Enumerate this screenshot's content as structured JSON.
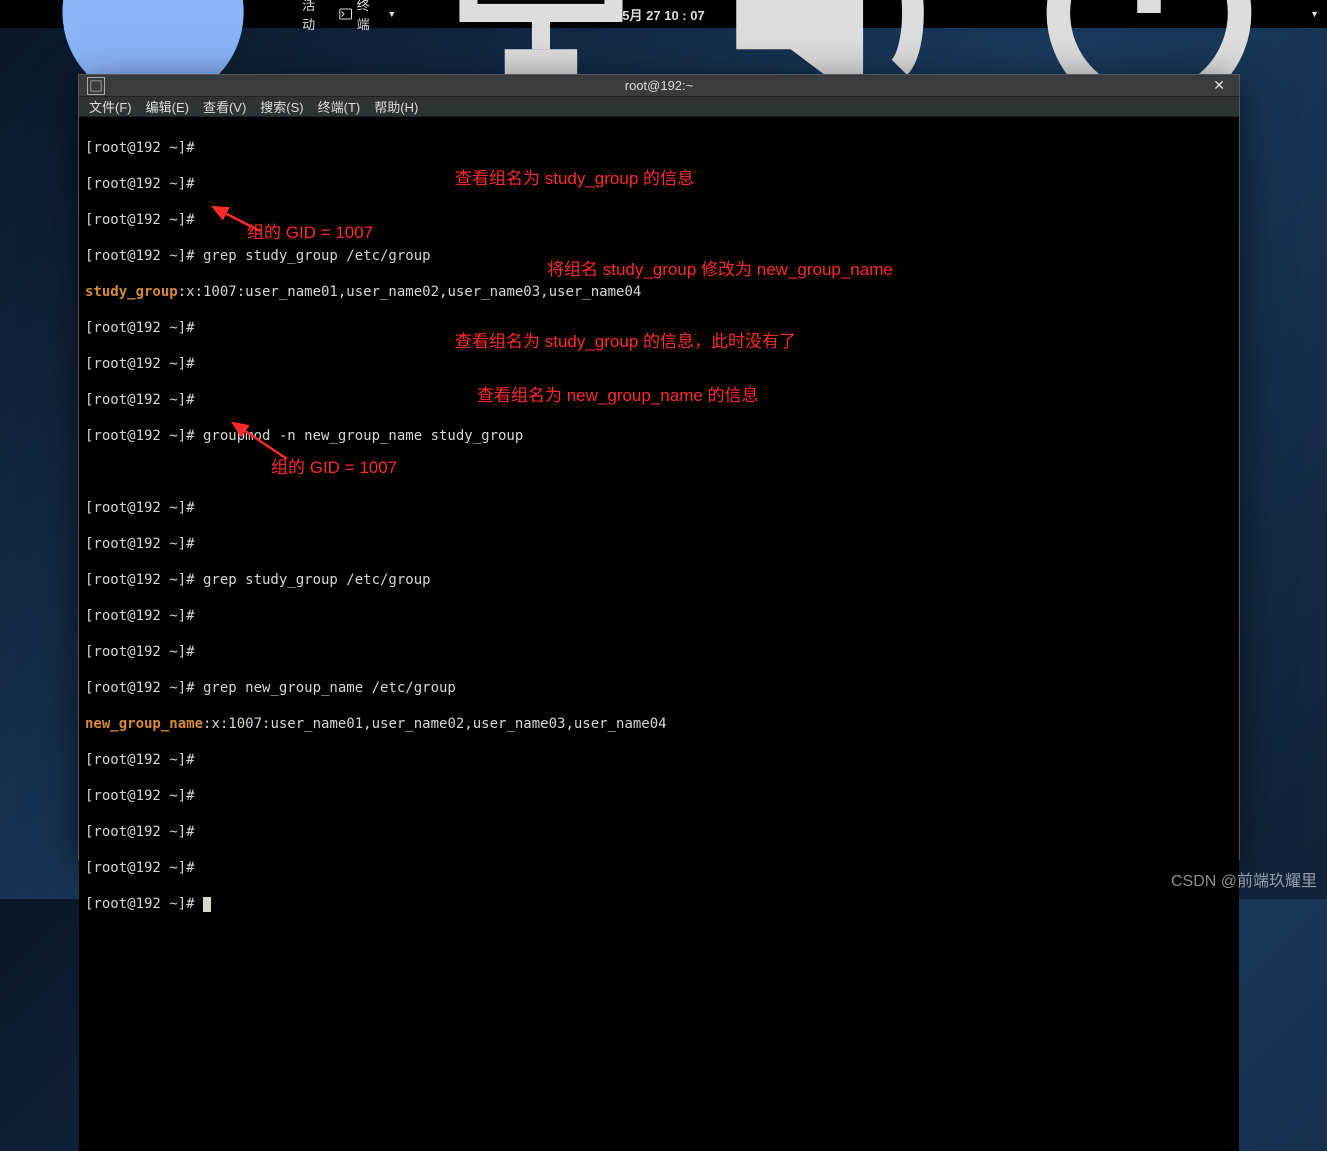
{
  "topbar": {
    "activities": "活动",
    "terminal_label": "终端",
    "clock": "5月 27 10 : 07"
  },
  "window": {
    "title": "root@192:~",
    "close": "✕"
  },
  "menubar": {
    "file": "文件(F)",
    "edit": "编辑(E)",
    "view": "查看(V)",
    "search": "搜索(S)",
    "terminal": "终端(T)",
    "help": "帮助(H)"
  },
  "lines": {
    "l1": "[root@192 ~]# ",
    "l2": "[root@192 ~]# ",
    "l3": "[root@192 ~]# ",
    "l4": "[root@192 ~]# grep study_group /etc/group",
    "l5a": "study_group",
    "l5b": ":x:1007:user_name01,user_name02,user_name03,user_name04",
    "l6": "[root@192 ~]# ",
    "l7": "[root@192 ~]# ",
    "l8": "[root@192 ~]# ",
    "l9": "[root@192 ~]# groupmod -n new_group_name study_group",
    "l10": "",
    "l11": "[root@192 ~]# ",
    "l12": "[root@192 ~]# ",
    "l13": "[root@192 ~]# grep study_group /etc/group",
    "l14": "[root@192 ~]# ",
    "l15": "[root@192 ~]# ",
    "l16": "[root@192 ~]# grep new_group_name /etc/group",
    "l17a": "new_group_name",
    "l17b": ":x:1007:user_name01,user_name02,user_name03,user_name04",
    "l18": "[root@192 ~]# ",
    "l19": "[root@192 ~]# ",
    "l20": "[root@192 ~]# ",
    "l21": "[root@192 ~]# ",
    "l22": "[root@192 ~]# "
  },
  "annotations": {
    "a1": "查看组名为 study_group 的信息",
    "a2": "组的 GID = 1007",
    "a3": "将组名 study_group 修改为 new_group_name",
    "a4": "查看组名为 study_group 的信息，此时没有了",
    "a5": "查看组名为 new_group_name 的信息",
    "a6": "组的 GID = 1007"
  },
  "watermark": "CSDN @前端玖耀里"
}
